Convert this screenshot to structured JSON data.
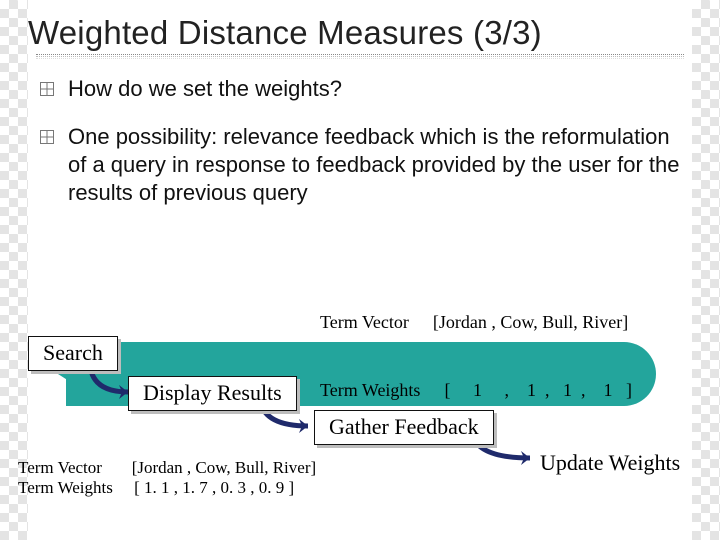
{
  "title": "Weighted Distance Measures (3/3)",
  "bullets": [
    "How do we set the weights?",
    "One possibility: relevance feedback which is the reformulation of a query in response to feedback provided by the user for the results of previous query"
  ],
  "steps": {
    "search": "Search",
    "display": "Display Results",
    "gather": "Gather Feedback",
    "update": "Update Weights"
  },
  "top_vector": {
    "label1": "Term Vector",
    "value1": "[Jordan , Cow, Bull, River]",
    "label2": "Term Weights",
    "value2": "[     1     ,    1  ,   1  ,    1   ]"
  },
  "bottom_vector": {
    "label1": "Term Vector",
    "value1": "[Jordan , Cow, Bull, River]",
    "label2": "Term Weights",
    "value2": "[   1. 1   ,  1. 7 ,  0. 3 ,  0. 9  ]"
  }
}
